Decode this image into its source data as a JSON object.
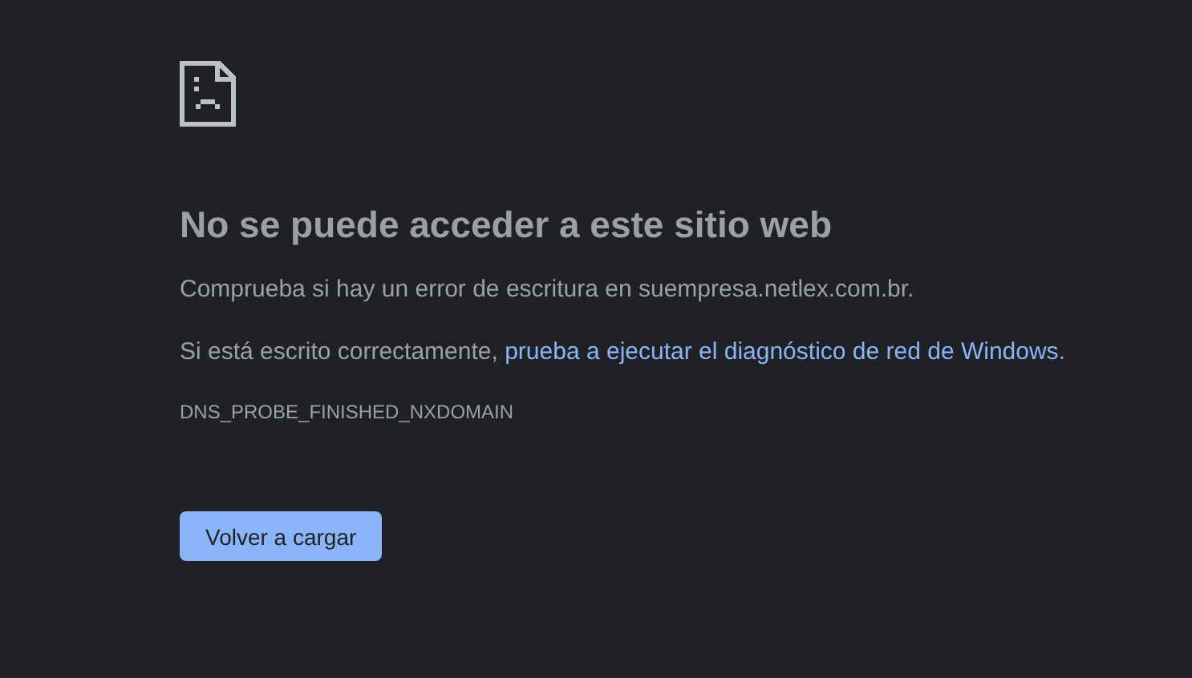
{
  "heading": "No se puede acceder a este sitio web",
  "message": "Comprueba si hay un error de escritura en suempresa.netlex.com.br.",
  "suggestion": {
    "prefix": "Si está escrito correctamente, ",
    "link": "prueba a ejecutar el diagnóstico de red de Windows",
    "suffix": "."
  },
  "error_code": "DNS_PROBE_FINISHED_NXDOMAIN",
  "reload_button": "Volver a cargar"
}
